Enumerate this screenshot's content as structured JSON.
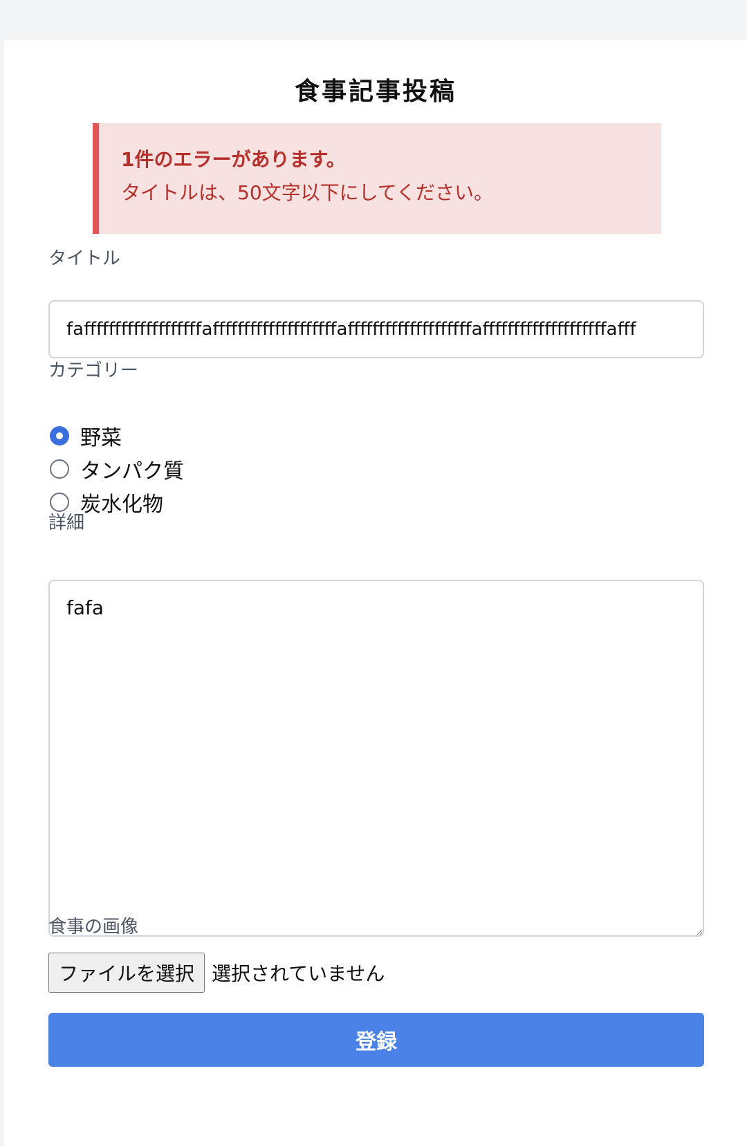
{
  "page": {
    "title": "食事記事投稿"
  },
  "alert": {
    "heading": "1件のエラーがあります。",
    "message": "タイトルは、50文字以下にしてください。",
    "accent_color": "#e05555",
    "background_color": "#f8e1e1",
    "text_color": "#b5302a"
  },
  "form": {
    "title_field": {
      "label": "タイトル",
      "value": "fafffffffffffffffffffaffffffffffffffffffffaffffffffffffffffffffaffffffffffffffffffffafff"
    },
    "category": {
      "label": "カテゴリー",
      "options": [
        {
          "label": "野菜",
          "checked": true
        },
        {
          "label": "タンパク質",
          "checked": false
        },
        {
          "label": "炭水化物",
          "checked": false
        }
      ]
    },
    "details_field": {
      "label": "詳細",
      "value": "fafa"
    },
    "image_field": {
      "label": "食事の画像",
      "button_label": "ファイルを選択",
      "status": "選択されていません"
    },
    "submit": {
      "label": "登録",
      "color": "#4b82e8"
    }
  }
}
